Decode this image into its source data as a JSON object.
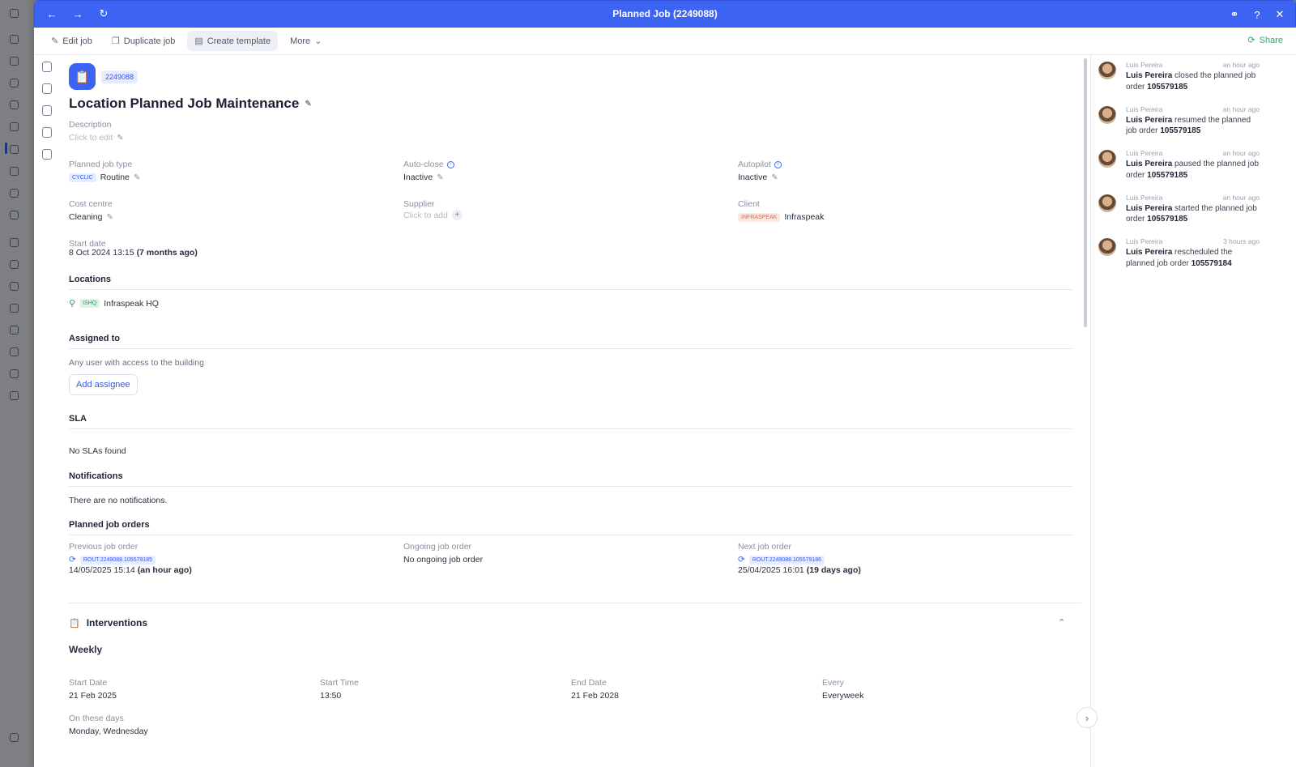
{
  "window": {
    "title": "Planned Job (2249088)"
  },
  "toolbar": {
    "edit_label": "Edit job",
    "duplicate_label": "Duplicate job",
    "template_label": "Create template",
    "more_label": "More",
    "share_label": "Share"
  },
  "job": {
    "id_badge": "2249088",
    "title": "Location Planned Job Maintenance",
    "description_label": "Description",
    "description_placeholder": "Click to edit"
  },
  "fields": {
    "planned_job_type": {
      "label": "Planned job type",
      "tag": "CYCLIC",
      "value": "Routine"
    },
    "auto_close": {
      "label": "Auto-close",
      "value": "Inactive"
    },
    "autopilot": {
      "label": "Autopilot",
      "value": "Inactive"
    },
    "cost_centre": {
      "label": "Cost centre",
      "value": "Cleaning"
    },
    "supplier": {
      "label": "Supplier",
      "placeholder": "Click to add"
    },
    "client": {
      "label": "Client",
      "tag": "INFRASPEAK",
      "value": "Infraspeak"
    },
    "start_date": {
      "label": "Start date",
      "value": "8 Oct 2024 13:15",
      "relative": "(7 months ago)"
    }
  },
  "locations": {
    "header": "Locations",
    "items": [
      {
        "code": "ISHQ",
        "name": "Infraspeak HQ"
      }
    ]
  },
  "assigned": {
    "header": "Assigned to",
    "text": "Any user with access to the building",
    "add_label": "Add assignee"
  },
  "sla": {
    "header": "SLA",
    "text": "No SLAs found"
  },
  "notifications": {
    "header": "Notifications",
    "text": "There are no notifications."
  },
  "orders": {
    "header": "Planned job orders",
    "previous": {
      "label": "Previous job order",
      "code": "ROUT.2249088.105579185",
      "date": "14/05/2025 15:14",
      "relative": "(an hour ago)"
    },
    "ongoing": {
      "label": "Ongoing job order",
      "value": "No ongoing job order"
    },
    "next": {
      "label": "Next job order",
      "code": "ROUT.2249088.105579186",
      "date": "25/04/2025 16:01",
      "relative": "(19 days ago)"
    }
  },
  "interventions": {
    "header": "Interventions",
    "frequency": "Weekly",
    "start_date": {
      "label": "Start Date",
      "value": "21 Feb 2025"
    },
    "start_time": {
      "label": "Start Time",
      "value": "13:50"
    },
    "end_date": {
      "label": "End Date",
      "value": "21 Feb 2028"
    },
    "every": {
      "label": "Every",
      "value": "Everyweek"
    },
    "days": {
      "label": "On these days",
      "value": "Monday, Wednesday"
    }
  },
  "activity": [
    {
      "user": "Luis Pereira",
      "time": "an hour ago",
      "actor": "Luis Pereira",
      "action": "closed the planned job order",
      "ref": "105579185"
    },
    {
      "user": "Luis Pereira",
      "time": "an hour ago",
      "actor": "Luis Pereira",
      "action": "resumed the planned job order",
      "ref": "105579185"
    },
    {
      "user": "Luis Pereira",
      "time": "an hour ago",
      "actor": "Luis Pereira",
      "action": "paused the planned job order",
      "ref": "105579185"
    },
    {
      "user": "Luis Pereira",
      "time": "an hour ago",
      "actor": "Luis Pereira",
      "action": "started the planned job order",
      "ref": "105579185"
    },
    {
      "user": "Luis Pereira",
      "time": "3 hours ago",
      "actor": "Luis Pereira",
      "action": "rescheduled the planned job order",
      "ref": "105579184"
    }
  ],
  "colors": {
    "accent": "#3d63f2",
    "share": "#2fa86a",
    "overlay": "rgba(20,22,30,0.55)"
  }
}
